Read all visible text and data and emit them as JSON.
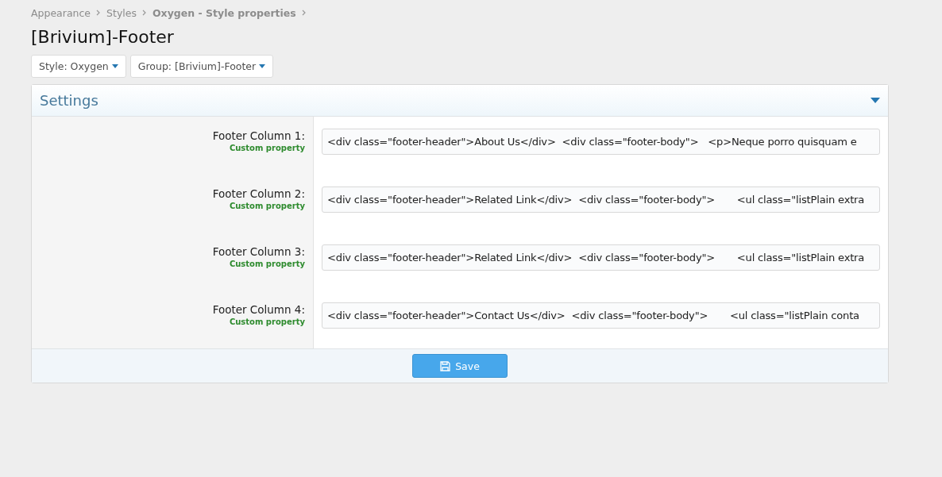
{
  "breadcrumb": [
    {
      "label": "Appearance",
      "bold": false
    },
    {
      "label": "Styles",
      "bold": false
    },
    {
      "label": "Oxygen - Style properties",
      "bold": true
    }
  ],
  "title": "[Brivium]-Footer",
  "filters": [
    {
      "label": "Style: Oxygen"
    },
    {
      "label": "Group: [Brivium]-Footer"
    }
  ],
  "panel": {
    "title": "Settings",
    "expanded": true,
    "rows": [
      {
        "label": "Footer Column 1:",
        "hint": "Custom property",
        "value": "<div class=\"footer-header\">About Us</div>  <div class=\"footer-body\">   <p>Neque porro quisquam e"
      },
      {
        "label": "Footer Column 2:",
        "hint": "Custom property",
        "value": "<div class=\"footer-header\">Related Link</div>  <div class=\"footer-body\">       <ul class=\"listPlain extra"
      },
      {
        "label": "Footer Column 3:",
        "hint": "Custom property",
        "value": "<div class=\"footer-header\">Related Link</div>  <div class=\"footer-body\">       <ul class=\"listPlain extra"
      },
      {
        "label": "Footer Column 4:",
        "hint": "Custom property",
        "value": "<div class=\"footer-header\">Contact Us</div>  <div class=\"footer-body\">       <ul class=\"listPlain conta"
      }
    ]
  },
  "save_button": "Save"
}
